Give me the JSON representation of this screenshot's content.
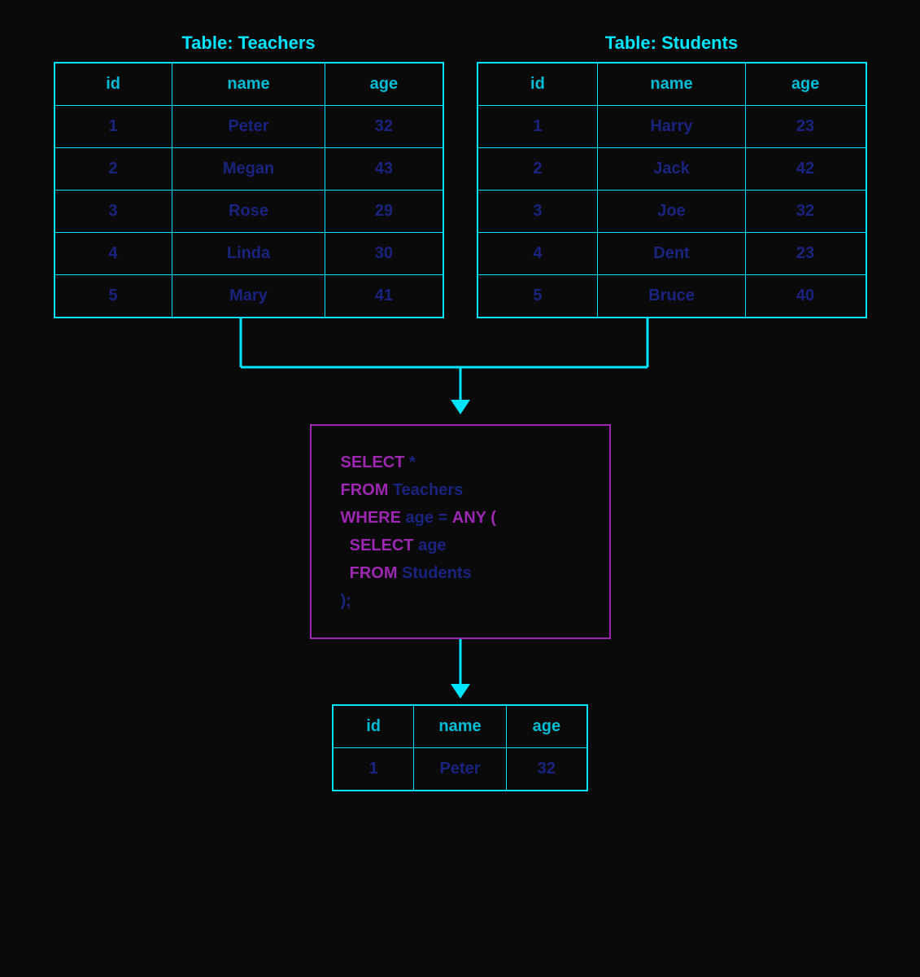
{
  "teachers": {
    "title": "Table: Teachers",
    "columns": [
      "id",
      "name",
      "age"
    ],
    "rows": [
      [
        1,
        "Peter",
        32
      ],
      [
        2,
        "Megan",
        43
      ],
      [
        3,
        "Rose",
        29
      ],
      [
        4,
        "Linda",
        30
      ],
      [
        5,
        "Mary",
        41
      ]
    ]
  },
  "students": {
    "title": "Table: Students",
    "columns": [
      "id",
      "name",
      "age"
    ],
    "rows": [
      [
        1,
        "Harry",
        23
      ],
      [
        2,
        "Jack",
        42
      ],
      [
        3,
        "Joe",
        32
      ],
      [
        4,
        "Dent",
        23
      ],
      [
        5,
        "Bruce",
        40
      ]
    ]
  },
  "sql": {
    "line1_kw": "SELECT",
    "line1_plain": " *",
    "line2_kw": "FROM",
    "line2_plain": " Teachers",
    "line3_kw": "WHERE",
    "line3_plain": " age = ",
    "line3_kw2": "ANY (",
    "line4_kw": "  SELECT",
    "line4_plain": " age",
    "line5_kw": "  FROM",
    "line5_plain": " Students",
    "line6_plain": ");"
  },
  "result": {
    "columns": [
      "id",
      "name",
      "age"
    ],
    "rows": [
      [
        1,
        "Peter",
        32
      ]
    ]
  }
}
